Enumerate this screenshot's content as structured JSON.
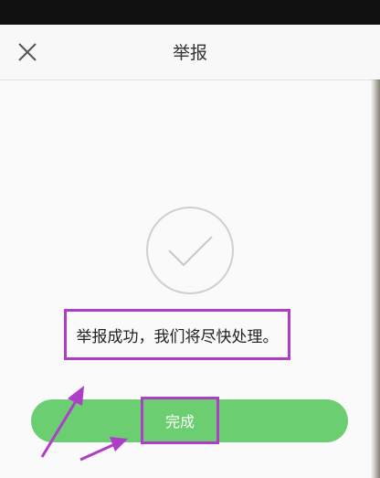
{
  "nav": {
    "title": "举报",
    "close_icon": "close-icon"
  },
  "result": {
    "icon": "checkmark-circle-icon",
    "message": "举报成功，我们将尽快处理。"
  },
  "actions": {
    "done_label": "完成"
  },
  "colors": {
    "accent_green": "#6bcf72",
    "annotation_purple": "#b03dc8",
    "status_bar": "#111111"
  }
}
